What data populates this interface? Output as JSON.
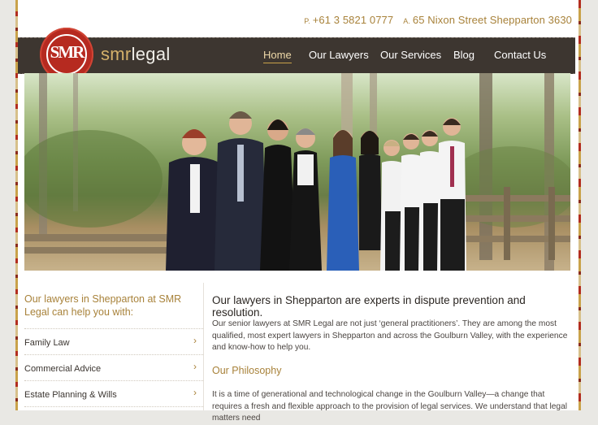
{
  "contact": {
    "phone_label": "P.",
    "phone": "+61 3 5821 0777",
    "address_label": "A.",
    "address": "65 Nixon Street Shepparton 3630"
  },
  "brand": {
    "monogram": "SMR",
    "name_part1": "smr",
    "name_part2": "legal",
    "accent": "#b62a20",
    "gold": "#a8823a",
    "nav_bg": "#3d3630"
  },
  "nav": {
    "items": [
      "Home",
      "Our Lawyers",
      "Our Services",
      "Blog",
      "Contact Us"
    ],
    "active": "Home"
  },
  "sidebar": {
    "title": "Our lawyers in Shepparton at SMR Legal can help you with:",
    "items": [
      "Family Law",
      "Commercial Advice",
      "Estate Planning & Wills"
    ]
  },
  "main": {
    "heading": "Our lawyers in Shepparton are experts in dispute prevention and resolution.",
    "paragraph1": "Our senior lawyers at SMR Legal are not just ‘general practitioners’. They are among the most qualified, most expert lawyers in Shepparton and across the Goulburn Valley, with the experience and know-how to help you.",
    "philosophy_heading": "Our Philosophy",
    "paragraph2": "It is a time of generational and technological change in the Goulburn Valley—a change that requires a fresh and flexible approach to the provision of legal services. We understand that legal matters need"
  }
}
